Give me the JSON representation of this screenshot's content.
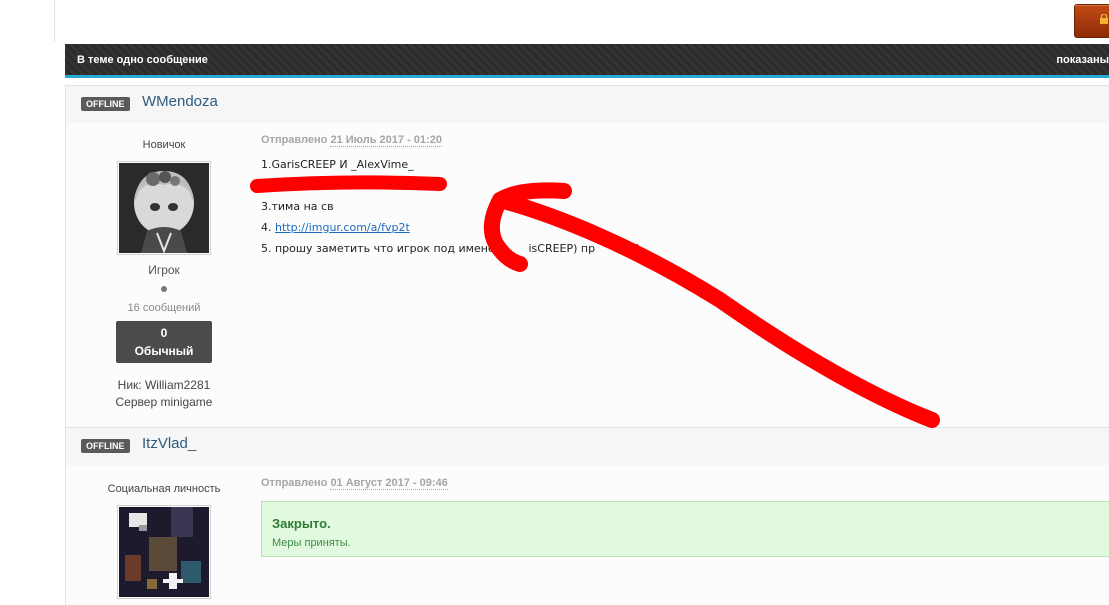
{
  "topic": {
    "message_count": "В теме одно сообщение",
    "shown_label": "показаны"
  },
  "posts": [
    {
      "status": "OFFLINE",
      "author": "WMendoza",
      "rank_title": "Новичок",
      "group": "Игрок",
      "post_count": "16 сообщений",
      "reputation": {
        "value": "0",
        "label": "Обычный"
      },
      "nick": "Ник: William2281",
      "server": "Сервер minigame",
      "date_prefix": "Отправлено",
      "date": "21 Июль 2017 - 01:20",
      "lines": {
        "line1": "1.GarisCREEP И _AlexVime_",
        "line3": "3.тима на св",
        "line4_prefix": "4. ",
        "line4_link": "http://imgur.com/a/fvp2t",
        "line5_a": "5. прошу заметить что игрок под именем ",
        "line5_b": "isCREEP) ",
        "line5_c": "пр",
        "line5_d": "!"
      }
    },
    {
      "status": "OFFLINE",
      "author": "ItzVlad_",
      "rank_title": "Социальная личность",
      "date_prefix": "Отправлено",
      "date": "01 Август 2017 - 09:46",
      "alert": {
        "title": "Закрыто.",
        "text": "Меры приняты."
      }
    }
  ],
  "colors": {
    "annotation_red": "#ff0000",
    "accent_blue": "#27a8d4",
    "closed_green": "#2d7a34"
  }
}
